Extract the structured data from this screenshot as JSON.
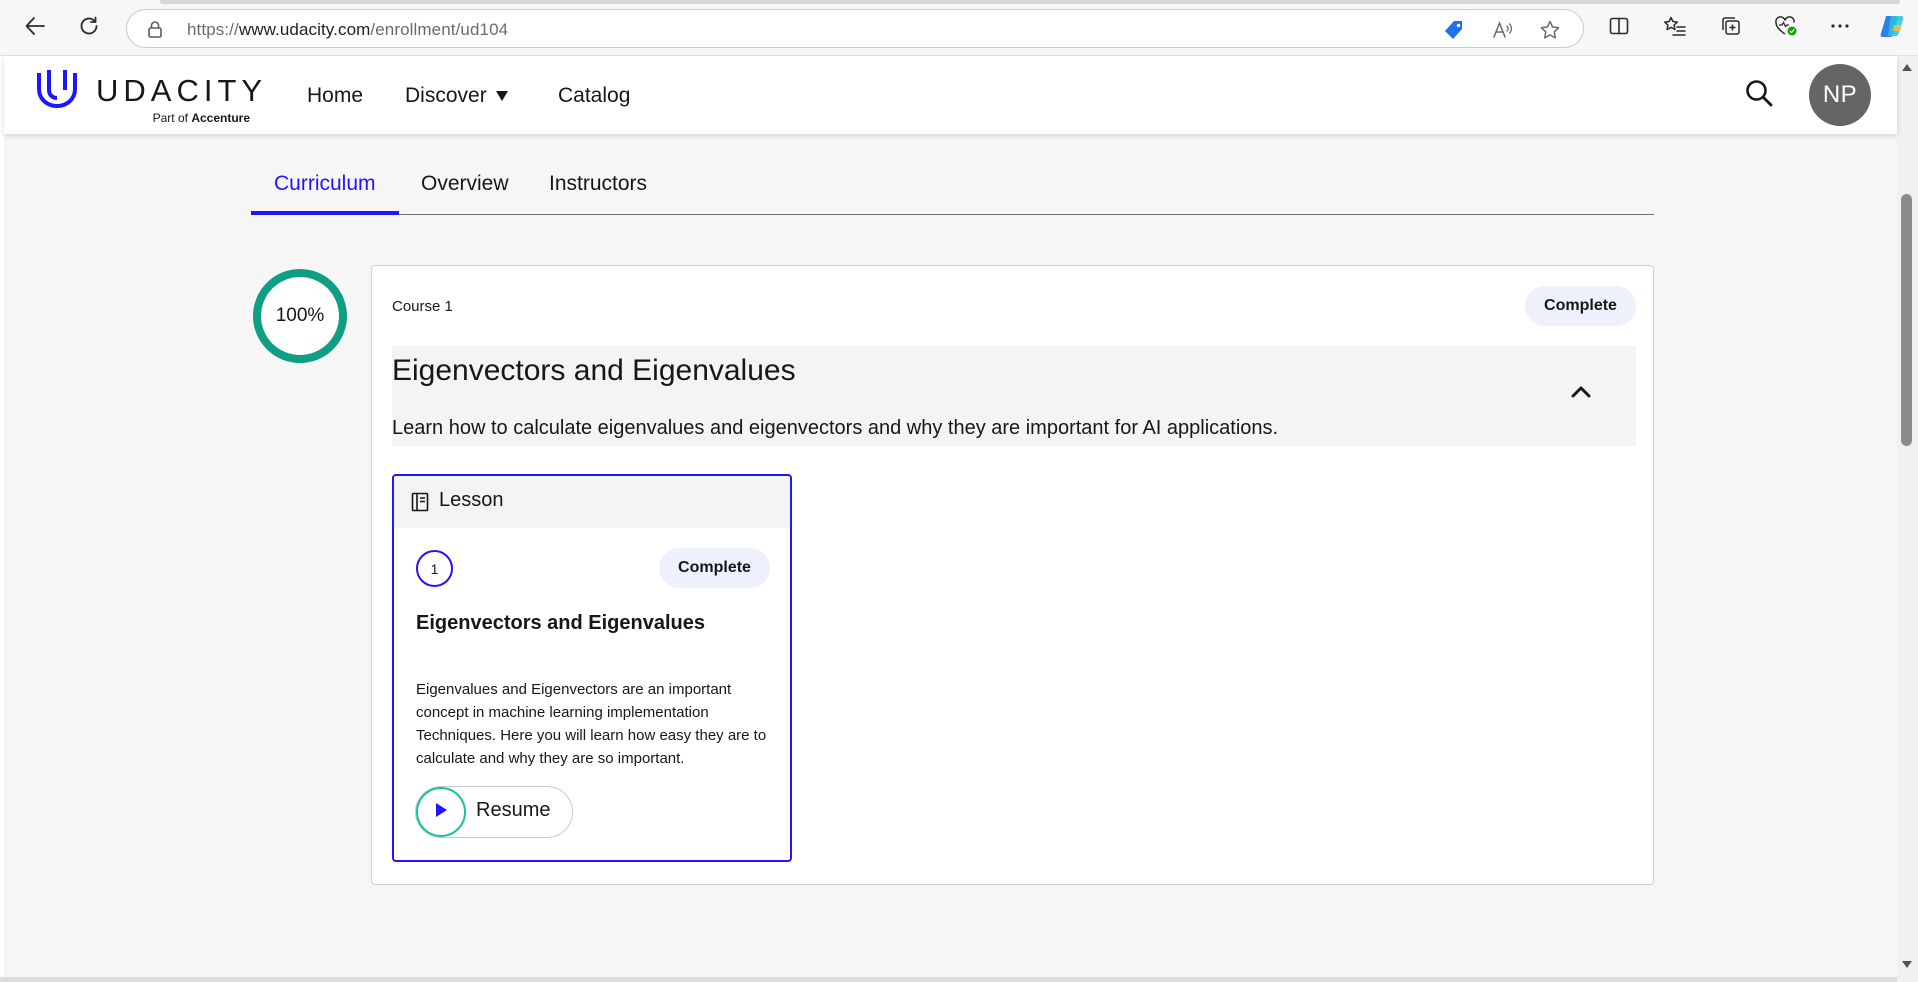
{
  "browser": {
    "url_prefix": "https://",
    "url_host": "www.udacity.com",
    "url_path": "/enrollment/ud104"
  },
  "site": {
    "logo_word": "UDACITY",
    "logo_sub_prefix": "Part of",
    "logo_sub_brand": "Accenture",
    "nav": {
      "home": "Home",
      "discover": "Discover",
      "catalog": "Catalog"
    },
    "avatar_initials": "NP"
  },
  "tabs": {
    "curriculum": "Curriculum",
    "overview": "Overview",
    "instructors": "Instructors",
    "active": "curriculum"
  },
  "progress": {
    "percent_label": "100%",
    "fraction": 1.0
  },
  "course": {
    "kicker": "Course 1",
    "status": "Complete",
    "title": "Eigenvectors and Eigenvalues",
    "description": "Learn how to calculate eigenvalues and eigenvectors and why they are important for AI applications."
  },
  "lesson": {
    "header_label": "Lesson",
    "number": "1",
    "status": "Complete",
    "title": "Eigenvectors and Eigenvalues",
    "description": "Eigenvalues and Eigenvectors are an important concept in machine learning implementation Techniques. Here you will learn how easy they are to calculate and why they are so important.",
    "resume_label": "Resume"
  },
  "colors": {
    "brand_blue": "#2015ff",
    "progress_teal": "#0d9e84",
    "resume_teal": "#15c2a0",
    "avatar_gray": "#656565"
  },
  "icons": {
    "back": "arrow-left-icon",
    "refresh": "refresh-icon",
    "lock": "lock-icon",
    "search": "search-icon",
    "collapse": "chevron-up-icon",
    "lesson": "document-icon",
    "play": "play-icon"
  }
}
